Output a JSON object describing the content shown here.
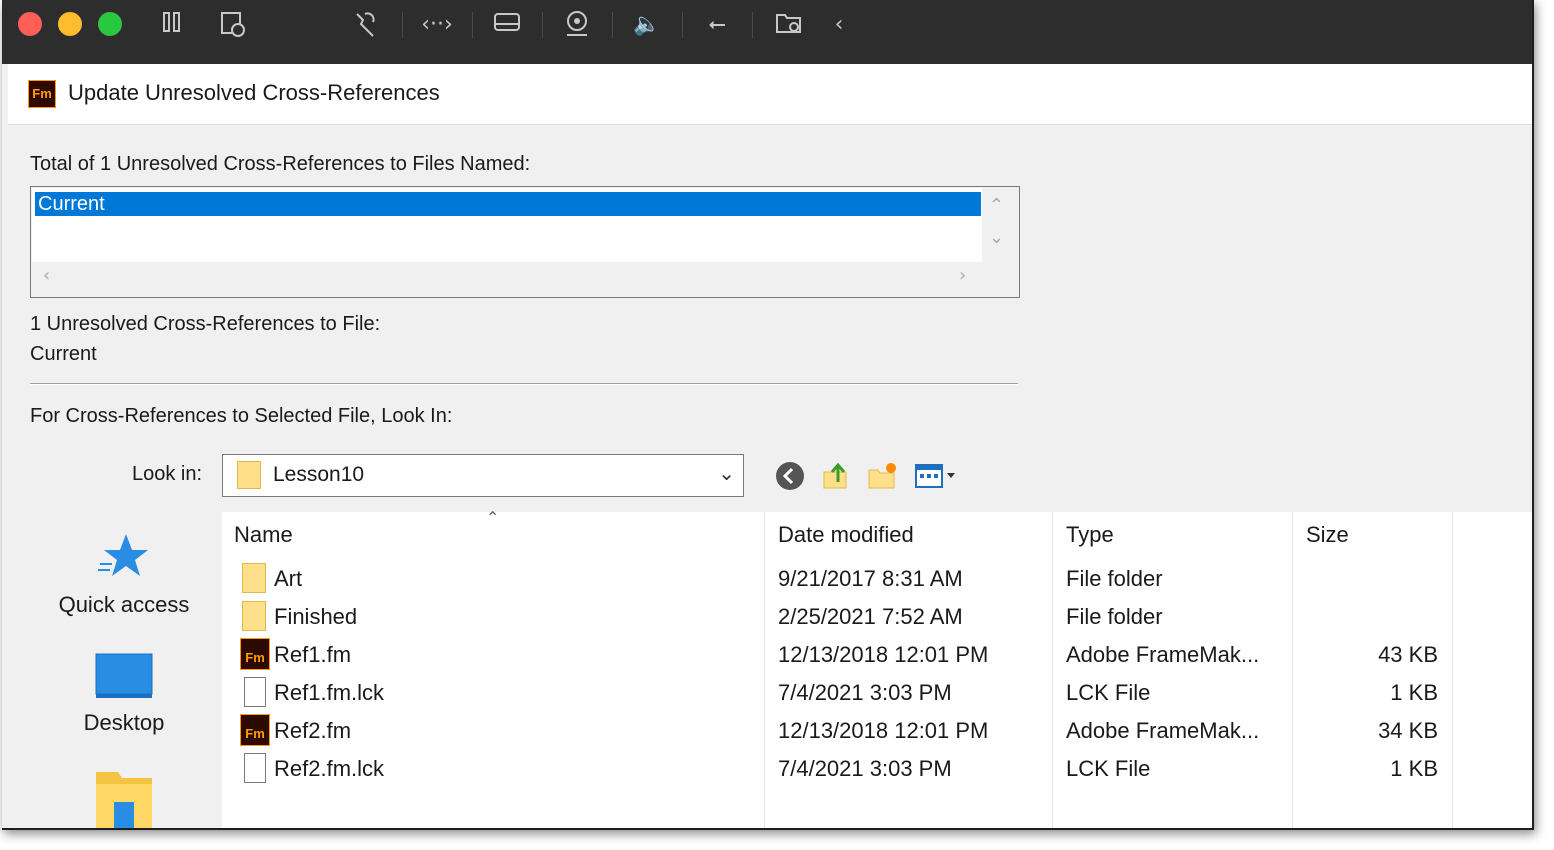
{
  "vm_toolbar": {
    "traffic_lights": {
      "close": "#ff5f57",
      "minimize": "#febc2e",
      "zoom": "#28c840"
    },
    "icons": [
      "pause-icon",
      "snapshot-icon",
      "wrench-icon",
      "code-arrows-icon",
      "drive-icon",
      "webcam-icon",
      "speaker-icon",
      "usb-icon",
      "shared-folder-icon",
      "chevron-left-icon"
    ]
  },
  "dialog": {
    "title": "Update Unresolved Cross-References",
    "app_logo": "Fm",
    "total_label": "Total of 1 Unresolved Cross-References to Files Named:",
    "files_named": [
      "Current"
    ],
    "selected_file_label": "1 Unresolved Cross-References to File:",
    "selected_file_value": "Current",
    "look_in_section_label": "For Cross-References to Selected File, Look In:",
    "look_in_label": "Look in:",
    "look_in_value": "Lesson10"
  },
  "places": [
    {
      "label": "Quick access",
      "icon": "star-icon"
    },
    {
      "label": "Desktop",
      "icon": "desktop-icon"
    },
    {
      "label": "",
      "icon": "libraries-icon"
    }
  ],
  "file_list": {
    "columns": [
      "Name",
      "Date modified",
      "Type",
      "Size"
    ],
    "rows": [
      {
        "name": "Art",
        "date": "9/21/2017 8:31 AM",
        "type": "File folder",
        "size": "",
        "icon": "folder-icon"
      },
      {
        "name": "Finished",
        "date": "2/25/2021 7:52 AM",
        "type": "File folder",
        "size": "",
        "icon": "folder-icon"
      },
      {
        "name": "Ref1.fm",
        "date": "12/13/2018 12:01 PM",
        "type": "Adobe FrameMak...",
        "size": "43 KB",
        "icon": "framemaker-file-icon"
      },
      {
        "name": "Ref1.fm.lck",
        "date": "7/4/2021 3:03 PM",
        "type": "LCK File",
        "size": "1 KB",
        "icon": "document-icon"
      },
      {
        "name": "Ref2.fm",
        "date": "12/13/2018 12:01 PM",
        "type": "Adobe FrameMak...",
        "size": "34 KB",
        "icon": "framemaker-file-icon"
      },
      {
        "name": "Ref2.fm.lck",
        "date": "7/4/2021 3:03 PM",
        "type": "LCK File",
        "size": "1 KB",
        "icon": "document-icon"
      }
    ]
  },
  "colors": {
    "selection": "#0078d7",
    "framemaker_accent": "#ff9a00"
  }
}
